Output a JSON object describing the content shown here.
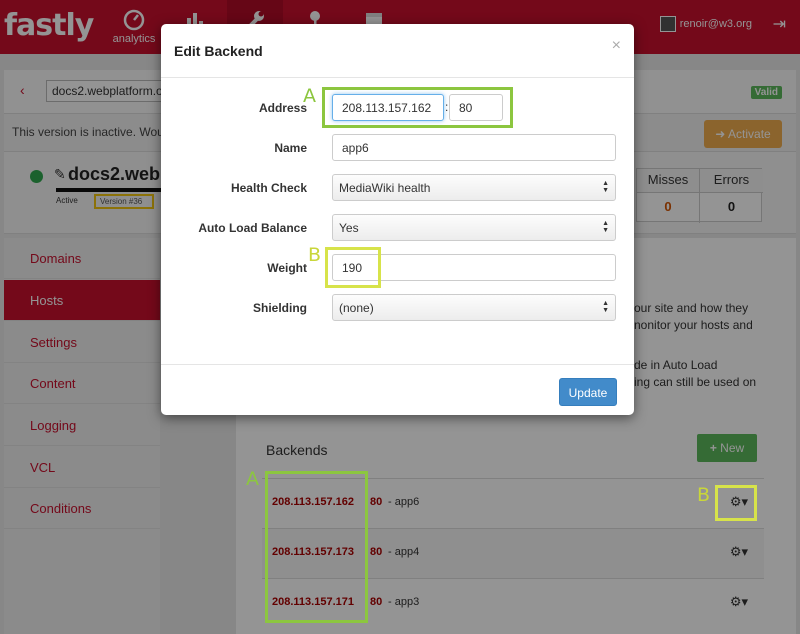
{
  "nav": {
    "logo": "fastly",
    "analytics_label": "analytics",
    "user": "renoir@w3.org"
  },
  "service": {
    "domain_input": "docs2.webplatform.o",
    "valid_badge": "Valid",
    "inactive_text": "This version is inactive. Wou",
    "activate_label": "Activate",
    "name": "docs2.webp",
    "active_label": "Active",
    "version_label": "Version #36"
  },
  "stats": {
    "misses_header": "Misses",
    "errors_header": "Errors",
    "misses_value": "0",
    "errors_value": "0"
  },
  "sidebar": {
    "items": [
      {
        "label": "Domains"
      },
      {
        "label": "Hosts"
      },
      {
        "label": "Settings"
      },
      {
        "label": "Content"
      },
      {
        "label": "Logging"
      },
      {
        "label": "VCL"
      },
      {
        "label": "Conditions"
      }
    ]
  },
  "background_text": {
    "line1": "our site and how they",
    "line2": "nonitor your hosts and",
    "line3": "de in Auto Load",
    "line4": "ing can still be used on"
  },
  "backends": {
    "title": "Backends",
    "new_label": "New",
    "rows": [
      {
        "address": "208.113.157.162",
        "port": "80",
        "name": "- app6"
      },
      {
        "address": "208.113.157.173",
        "port": "80",
        "name": "- app4"
      },
      {
        "address": "208.113.157.171",
        "port": "80",
        "name": "- app3"
      }
    ]
  },
  "modal": {
    "title": "Edit Backend",
    "close": "×",
    "address_label": "Address",
    "address_value": "208.113.157.162",
    "port_value": "80",
    "name_label": "Name",
    "name_value": "app6",
    "health_label": "Health Check",
    "health_value": "MediaWiki health",
    "autolb_label": "Auto Load Balance",
    "autolb_value": "Yes",
    "weight_label": "Weight",
    "weight_value": "190",
    "shielding_label": "Shielding",
    "shielding_value": "(none)",
    "update_label": "Update"
  },
  "annotations": {
    "a": "A",
    "b": "B"
  }
}
